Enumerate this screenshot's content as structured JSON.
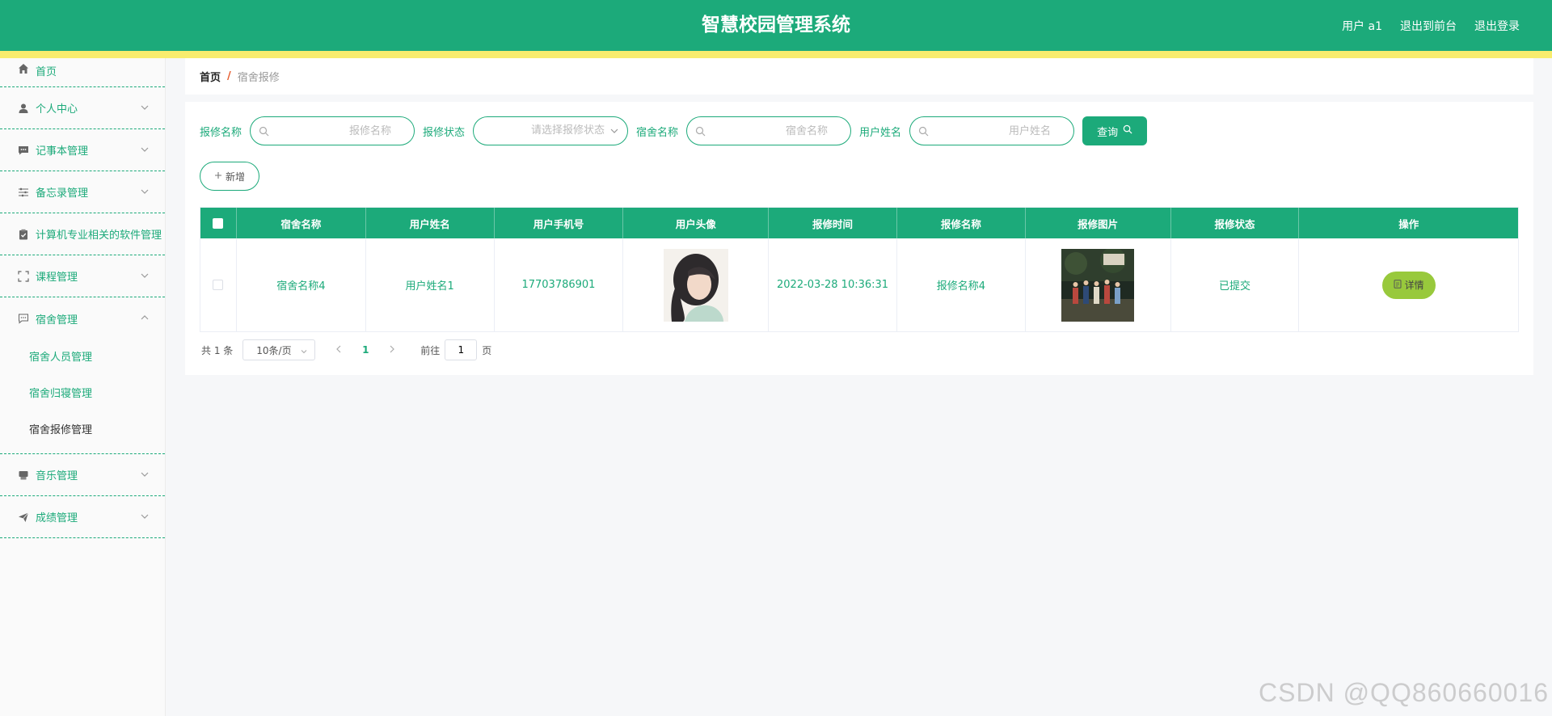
{
  "header": {
    "title": "智慧校园管理系统",
    "user": "用户 a1",
    "to_front": "退出到前台",
    "logout": "退出登录",
    "color": "#1caa7a",
    "stripe_color": "#f8ec6e"
  },
  "sidebar": {
    "items": [
      {
        "label": "首页",
        "icon": "home-icon"
      },
      {
        "label": "个人中心",
        "icon": "user-icon"
      },
      {
        "label": "记事本管理",
        "icon": "chat-icon"
      },
      {
        "label": "备忘录管理",
        "icon": "sliders-icon"
      },
      {
        "label": "计算机专业相关的软件管理",
        "icon": "clipboard-icon"
      },
      {
        "label": "课程管理",
        "icon": "fullscreen-icon"
      },
      {
        "label": "宿舍管理",
        "icon": "message-icon"
      },
      {
        "label": "音乐管理",
        "icon": "printer-icon"
      },
      {
        "label": "成绩管理",
        "icon": "send-icon"
      }
    ],
    "dorm_sub": [
      {
        "label": "宿舍人员管理"
      },
      {
        "label": "宿舍归寝管理"
      },
      {
        "label": "宿舍报修管理"
      }
    ]
  },
  "breadcrumb": {
    "home": "首页",
    "sep": "/",
    "current": "宿舍报修"
  },
  "search": {
    "repair_name_label": "报修名称",
    "repair_name_placeholder": "报修名称",
    "repair_status_label": "报修状态",
    "repair_status_placeholder": "请选择报修状态",
    "dorm_name_label": "宿舍名称",
    "dorm_name_placeholder": "宿舍名称",
    "user_name_label": "用户姓名",
    "user_name_placeholder": "用户姓名",
    "query_label": "查询"
  },
  "actions": {
    "add_label": "新增"
  },
  "table": {
    "headers": [
      "宿舍名称",
      "用户姓名",
      "用户手机号",
      "用户头像",
      "报修时间",
      "报修名称",
      "报修图片",
      "报修状态",
      "操作"
    ],
    "rows": [
      {
        "dorm_name": "宿舍名称4",
        "user_name": "用户姓名1",
        "phone": "17703786901",
        "repair_time": "2022-03-28 10:36:31",
        "repair_name": "报修名称4",
        "status": "已提交",
        "detail_label": "详情"
      }
    ]
  },
  "pagination": {
    "total": "共 1 条",
    "page_size": "10条/页",
    "current_page": "1",
    "goto_label": "前往",
    "goto_value": "1",
    "page_suffix": "页"
  },
  "watermark": "CSDN @QQ860660016"
}
